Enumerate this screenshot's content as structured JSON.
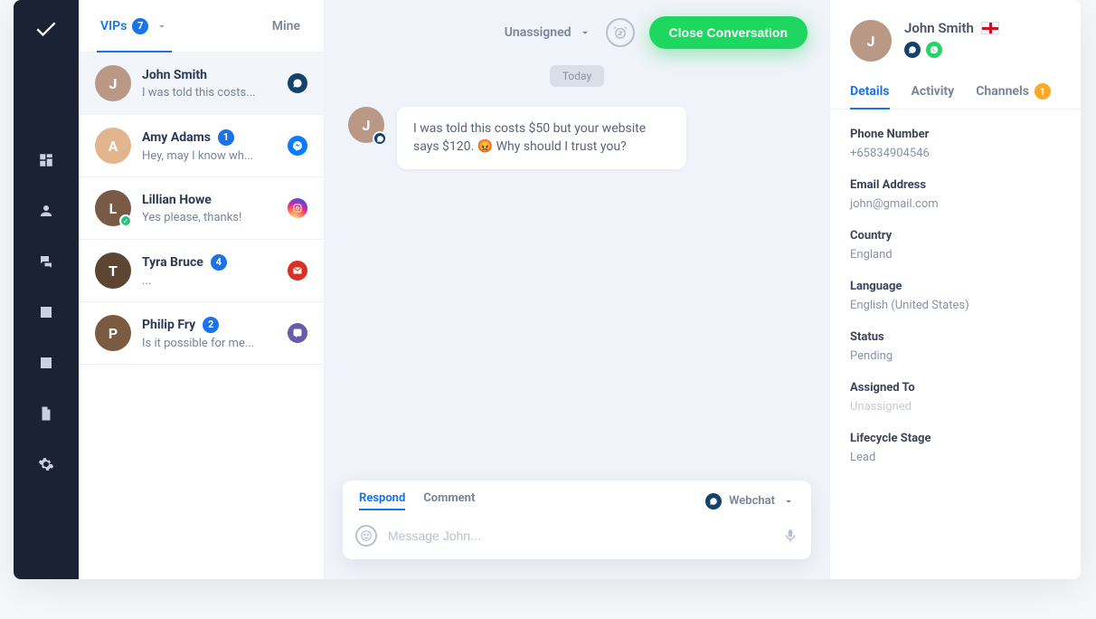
{
  "rail": {
    "icons": [
      "dashboard",
      "contacts",
      "chats",
      "tasks",
      "reports",
      "files",
      "settings"
    ]
  },
  "cl_tabs": {
    "vips_label": "VIPs",
    "vips_count": "7",
    "mine_label": "Mine"
  },
  "conversations": [
    {
      "name": "John Smith",
      "preview": "I was told this costs...",
      "badge": null,
      "channel": "webchat"
    },
    {
      "name": "Amy Adams",
      "preview": "Hey, may I know wh...",
      "badge": "1",
      "channel": "messenger"
    },
    {
      "name": "Lillian Howe",
      "preview": "Yes please, thanks!",
      "badge": null,
      "channel": "instagram",
      "statusCheck": true
    },
    {
      "name": "Tyra Bruce",
      "preview": "...",
      "badge": "4",
      "channel": "gmail"
    },
    {
      "name": "Philip Fry",
      "preview": "Is it possible for me...",
      "badge": "2",
      "channel": "viber"
    }
  ],
  "header": {
    "assigned_label": "Unassigned",
    "close_label": "Close Conversation"
  },
  "thread": {
    "date_label": "Today",
    "message": "I was told this costs $50 but your website says $120. 😡 Why should I trust you?"
  },
  "composer": {
    "respond_label": "Respond",
    "comment_label": "Comment",
    "channel_label": "Webchat",
    "placeholder": "Message John..."
  },
  "profile": {
    "name": "John Smith",
    "tabs": {
      "details": "Details",
      "activity": "Activity",
      "channels": "Channels",
      "channels_count": "1"
    },
    "fields": {
      "phone_label": "Phone Number",
      "phone_value": "+65834904546",
      "email_label": "Email Address",
      "email_value": "john@gmail.com",
      "country_label": "Country",
      "country_value": "England",
      "language_label": "Language",
      "language_value": "English (United States)",
      "status_label": "Status",
      "status_value": "Pending",
      "assigned_label": "Assigned To",
      "assigned_value": "Unassigned",
      "lifecycle_label": "Lifecycle Stage",
      "lifecycle_value": "Lead"
    }
  }
}
